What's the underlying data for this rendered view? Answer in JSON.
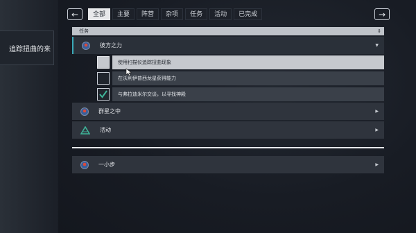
{
  "left_panel": {
    "text": "追踪扭曲的来"
  },
  "nav": {
    "prev": "←",
    "next": "→"
  },
  "tabs": [
    "全部",
    "主要",
    "阵营",
    "杂项",
    "任务",
    "活动",
    "已完成"
  ],
  "header": {
    "label": "任务",
    "sort_icon": "⇕"
  },
  "quests": [
    {
      "label": "彼方之力",
      "icon": "planet-icon",
      "arrow": "▼"
    },
    {
      "label": "群星之中",
      "icon": "planet-icon",
      "arrow": "▶"
    },
    {
      "label": "活动",
      "icon": "triangle-icon",
      "arrow": "▶"
    },
    {
      "label": "一小步",
      "icon": "planet-icon",
      "arrow": "▶"
    }
  ],
  "objectives": [
    {
      "label": "使用扫描仪追踪扭曲现象",
      "checked": false,
      "selected": true
    },
    {
      "label": "在沃利伊普西龙星获得能力",
      "checked": false,
      "selected": false
    },
    {
      "label": "与弗拉迪米尔交谈，以寻找神殿",
      "checked": true,
      "selected": false
    }
  ],
  "colors": {
    "accent": "#3aaab8",
    "check": "#3fb59a"
  }
}
